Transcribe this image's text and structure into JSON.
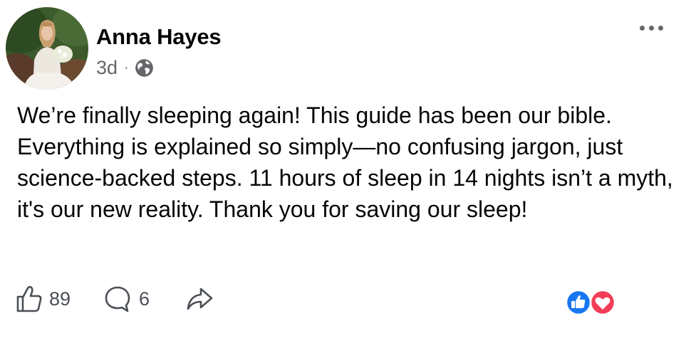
{
  "post": {
    "author": "Anna Hayes",
    "time": "3d",
    "separator": "·",
    "privacy_icon": "globe-icon",
    "more_icon": "more-options-icon",
    "text": "We’re finally sleeping again! This guide has been our bible. Everything is explained so simply—no confusing jargon, just science-backed steps. 11 hours of sleep in 14 nights isn’t a myth, it's our new reality. Thank you for saving our sleep!"
  },
  "actions": {
    "like_icon": "thumbs-up-outline-icon",
    "like_count": "89",
    "comment_icon": "comment-bubble-icon",
    "comment_count": "6",
    "share_icon": "share-arrow-icon"
  },
  "reactions": [
    "like",
    "love"
  ],
  "colors": {
    "text": "#050505",
    "secondary": "#65676b",
    "like_blue": "#1877f2",
    "love_red": "#f33e58"
  }
}
